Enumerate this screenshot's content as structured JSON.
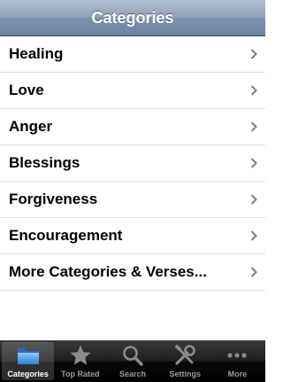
{
  "navbar": {
    "title": "Categories"
  },
  "categories": [
    {
      "label": "Healing"
    },
    {
      "label": "Love"
    },
    {
      "label": "Anger"
    },
    {
      "label": "Blessings"
    },
    {
      "label": "Forgiveness"
    },
    {
      "label": "Encouragement"
    },
    {
      "label": "More Categories & Verses..."
    }
  ],
  "tabbar": {
    "tabs": [
      {
        "label": "Categories",
        "icon": "folder-icon",
        "selected": true
      },
      {
        "label": "Top Rated",
        "icon": "star-icon",
        "selected": false
      },
      {
        "label": "Search",
        "icon": "magnifier-icon",
        "selected": false
      },
      {
        "label": "Settings",
        "icon": "tools-icon",
        "selected": false
      },
      {
        "label": "More",
        "icon": "ellipsis-icon",
        "selected": false
      }
    ]
  },
  "colors": {
    "navbar": "#8ea1ba",
    "tab_selected_icon": "#4a9be0",
    "tab_inactive": "#9a9a9a"
  }
}
